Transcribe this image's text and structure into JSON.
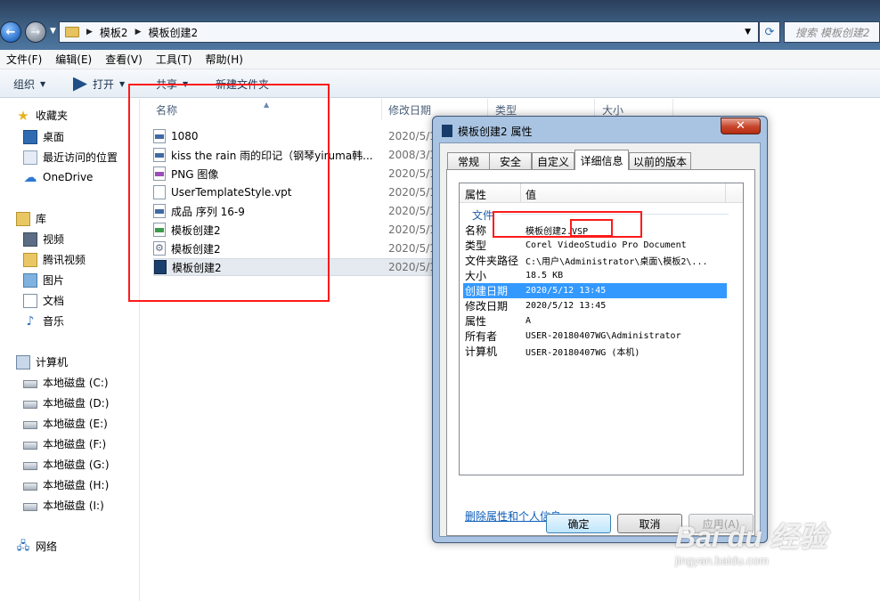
{
  "address_bar": {
    "crumbs": [
      "模板2",
      "模板创建2"
    ],
    "search_placeholder": "搜索 模板创建2"
  },
  "menu": [
    "文件(F)",
    "编辑(E)",
    "查看(V)",
    "工具(T)",
    "帮助(H)"
  ],
  "toolbar": {
    "organize": "组织",
    "open": "打开",
    "share": "共享",
    "new_folder": "新建文件夹"
  },
  "sidebar": {
    "favorites": "收藏夹",
    "favorites_items": [
      "桌面",
      "最近访问的位置",
      "OneDrive"
    ],
    "libraries": "库",
    "library_items": [
      "视频",
      "腾讯视频",
      "图片",
      "文档",
      "音乐"
    ],
    "computer": "计算机",
    "drives": [
      "本地磁盘 (C:)",
      "本地磁盘 (D:)",
      "本地磁盘 (E:)",
      "本地磁盘 (F:)",
      "本地磁盘 (G:)",
      "本地磁盘 (H:)",
      "本地磁盘 (I:)"
    ],
    "network": "网络"
  },
  "file_list": {
    "columns": [
      "名称",
      "修改日期",
      "类型",
      "大小"
    ],
    "rows": [
      {
        "name": "1080",
        "date": "2020/5/1"
      },
      {
        "name": "kiss the rain 雨的印记（钢琴yiruma韩...",
        "date": "2008/3/1"
      },
      {
        "name": "PNG 图像",
        "date": "2020/5/1"
      },
      {
        "name": "UserTemplateStyle.vpt",
        "date": "2020/5/1"
      },
      {
        "name": "成品 序列 16-9",
        "date": "2020/5/1"
      },
      {
        "name": "模板创建2",
        "date": "2020/5/1"
      },
      {
        "name": "模板创建2",
        "date": "2020/5/1"
      },
      {
        "name": "模板创建2",
        "date": "2020/5/1"
      }
    ]
  },
  "dialog": {
    "title": "模板创建2 属性",
    "close": "✕",
    "tabs": [
      "常规",
      "安全",
      "自定义",
      "详细信息",
      "以前的版本"
    ],
    "header_property": "属性",
    "header_value": "值",
    "group": "文件",
    "properties": [
      {
        "k": "名称",
        "v": "模板创建2.VSP"
      },
      {
        "k": "类型",
        "v": "Corel VideoStudio Pro Document"
      },
      {
        "k": "文件夹路径",
        "v": "C:\\用户\\Administrator\\桌面\\模板2\\..."
      },
      {
        "k": "大小",
        "v": "18.5 KB"
      },
      {
        "k": "创建日期",
        "v": "2020/5/12 13:45"
      },
      {
        "k": "修改日期",
        "v": "2020/5/12 13:45"
      },
      {
        "k": "属性",
        "v": "A"
      },
      {
        "k": "所有者",
        "v": "USER-20180407WG\\Administrator"
      },
      {
        "k": "计算机",
        "v": "USER-20180407WG (本机)"
      }
    ],
    "remove_link": "删除属性和个人信息",
    "ok": "确定",
    "cancel": "取消",
    "apply": "应用(A)"
  },
  "watermark": {
    "brand": "Bai du 经验",
    "url": "jingyan.baidu.com"
  },
  "colors": {
    "selection": "#3399ff",
    "highlight_box": "#ff1a1a",
    "link": "#0b5cb8"
  }
}
